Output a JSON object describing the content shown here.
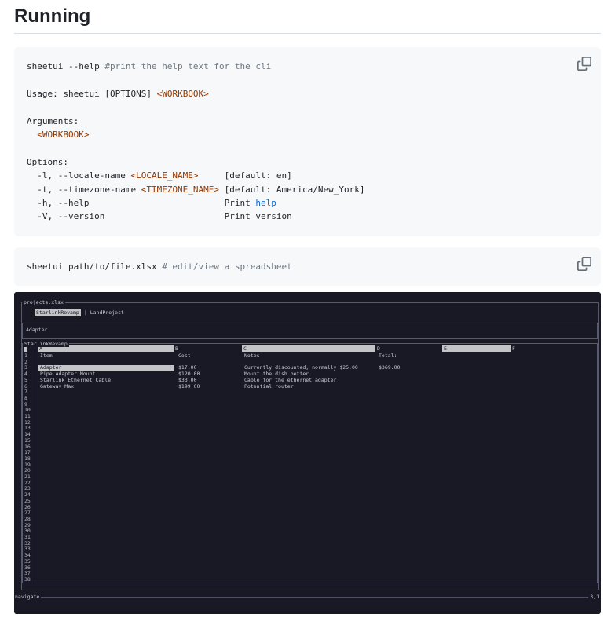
{
  "heading": {
    "title": "Running"
  },
  "icons": {
    "copy": "copy-icon"
  },
  "code_blocks": {
    "block1": {
      "lines": [
        {
          "segments": [
            {
              "text": "sheetui --help ",
              "color": "plain"
            },
            {
              "text": "#print the help text for the cli",
              "color": "comment"
            }
          ]
        },
        {
          "segments": []
        },
        {
          "segments": [
            {
              "text": "Usage: sheetui [OPTIONS] ",
              "color": "plain"
            },
            {
              "text": "<WORKBOOK>",
              "color": "red"
            }
          ]
        },
        {
          "segments": []
        },
        {
          "segments": [
            {
              "text": "Arguments:",
              "color": "plain"
            }
          ]
        },
        {
          "segments": [
            {
              "text": "  ",
              "color": "plain"
            },
            {
              "text": "<WORKBOOK>",
              "color": "red"
            }
          ]
        },
        {
          "segments": []
        },
        {
          "segments": [
            {
              "text": "Options:",
              "color": "plain"
            }
          ]
        },
        {
          "segments": [
            {
              "text": "  -l, --locale-name ",
              "color": "plain"
            },
            {
              "text": "<LOCALE_NAME>",
              "color": "red"
            },
            {
              "text": "     [default: en]",
              "color": "plain"
            }
          ]
        },
        {
          "segments": [
            {
              "text": "  -t, --timezone-name ",
              "color": "plain"
            },
            {
              "text": "<TIMEZONE_NAME>",
              "color": "red"
            },
            {
              "text": " [default: America/New_York]",
              "color": "plain"
            }
          ]
        },
        {
          "segments": [
            {
              "text": "  -h, --help                          Print ",
              "color": "plain"
            },
            {
              "text": "help",
              "color": "blue"
            }
          ]
        },
        {
          "segments": [
            {
              "text": "  -V, --version                       Print version",
              "color": "plain"
            }
          ]
        }
      ]
    },
    "block2": {
      "lines": [
        {
          "segments": [
            {
              "text": "sheetui path/to/file.xlsx ",
              "color": "plain"
            },
            {
              "text": "# edit/view a spreadsheet",
              "color": "comment"
            }
          ]
        }
      ]
    }
  },
  "terminal": {
    "workbook_title": "projects.xlsx",
    "tabs": [
      {
        "label": "StarlinkRevamp",
        "selected": true
      },
      {
        "label": "LandProject",
        "selected": false
      }
    ],
    "tab_separator": "|",
    "cell_input_value": "Adapter",
    "sheet_frame_title": "StarlinkRevamp",
    "grid": {
      "header": [
        {
          "letter": "A",
          "highlighted": true
        },
        {
          "letter": "B",
          "highlighted": false
        },
        {
          "letter": "C",
          "highlighted": true
        },
        {
          "letter": "D",
          "highlighted": false
        },
        {
          "letter": "E",
          "highlighted": true
        },
        {
          "letter": "F",
          "highlighted": false
        }
      ],
      "row_count": 38,
      "rows": [
        {
          "n": 1,
          "item": "Item",
          "cost": "Cost",
          "notes": "Notes",
          "total": "Total:"
        },
        {
          "n": 3,
          "item": "Adapter",
          "cost": "$17.00",
          "notes": "Currently discounted, normally $25.00",
          "total": "$369.00",
          "selected": true
        },
        {
          "n": 4,
          "item": "Pipe Adapter Mount",
          "cost": "$120.00",
          "notes": "Mount the dish better"
        },
        {
          "n": 5,
          "item": "Starlink Ethernet Cable",
          "cost": "$33.00",
          "notes": "Cable for the ethernet adapter"
        },
        {
          "n": 6,
          "item": "Gateway Max",
          "cost": "$199.00",
          "notes": "Potential router"
        }
      ],
      "selected_cell": "Adapter"
    },
    "status": {
      "mode": "navigate",
      "position": "3,1"
    },
    "colors": {
      "background": "#191926",
      "highlight": "#c3c4c8",
      "text": "#ccccd6",
      "border": "#585a72"
    }
  }
}
